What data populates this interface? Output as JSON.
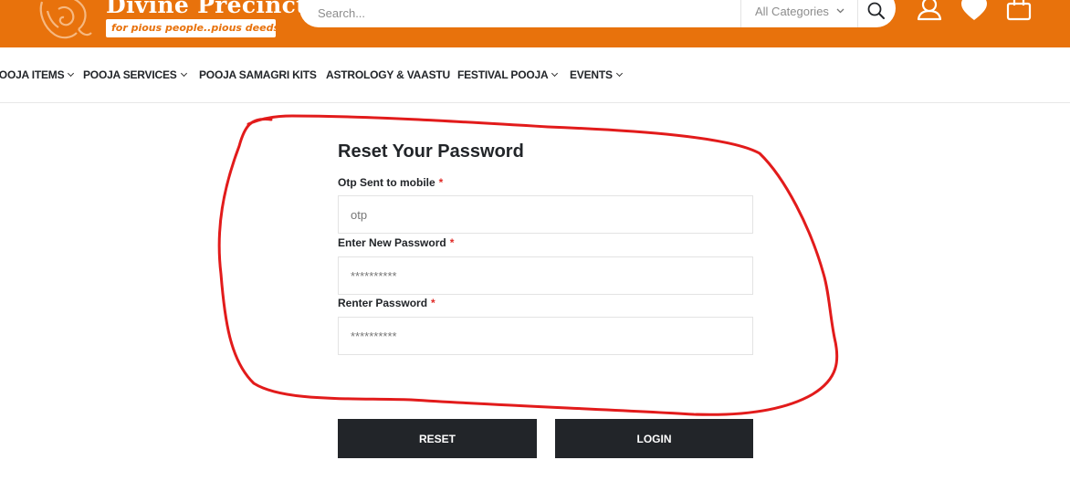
{
  "header": {
    "logo_title": "Divine Precincts",
    "logo_tagline": "for pious people..pious deeds",
    "search_placeholder": "Search...",
    "category_select": "All Categories",
    "icons": [
      "user-icon",
      "heart-icon",
      "cart-icon"
    ],
    "bg_color": "#e8720c"
  },
  "nav": {
    "items": [
      {
        "label": "POOJA ITEMS",
        "dropdown": true
      },
      {
        "label": "POOJA SERVICES",
        "dropdown": true
      },
      {
        "label": "POOJA SAMAGRI KITS",
        "dropdown": false
      },
      {
        "label": "ASTROLOGY & VAASTU",
        "dropdown": false
      },
      {
        "label": "FESTIVAL POOJA",
        "dropdown": true
      },
      {
        "label": "EVENTS",
        "dropdown": true
      }
    ]
  },
  "form": {
    "title": "Reset Your Password",
    "required_mark": "*",
    "fields": [
      {
        "label": "Otp Sent to mobile",
        "placeholder": "otp",
        "type": "text"
      },
      {
        "label": "Enter New Password",
        "placeholder": "**********",
        "type": "text"
      },
      {
        "label": "Renter Password",
        "placeholder": "**********",
        "type": "text"
      }
    ],
    "reset_button": "RESET",
    "login_button": "LOGIN",
    "button_color": "#222529",
    "required_color": "#e02b27"
  },
  "annotation": {
    "color": "#e21b1b"
  }
}
